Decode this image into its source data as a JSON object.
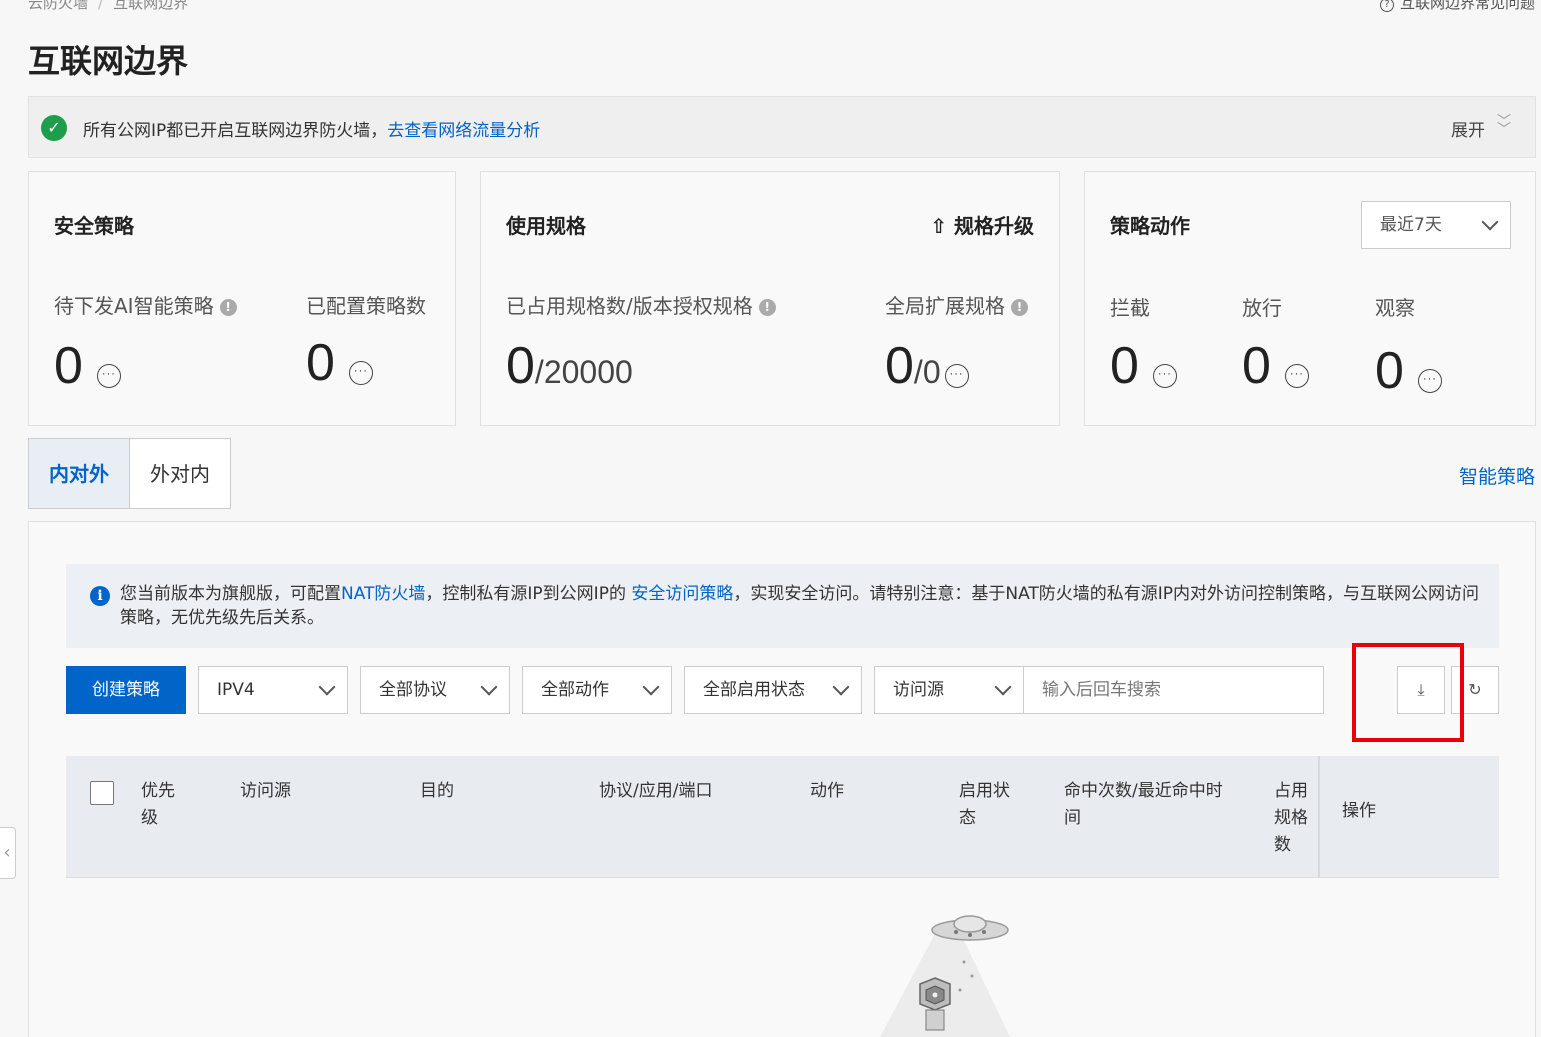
{
  "breadcrumb": {
    "parent": "云防火墙",
    "current": "互联网边界"
  },
  "help_link": "互联网边界常见问题",
  "page_title": "互联网边界",
  "notice": {
    "text": "所有公网IP都已开启互联网边界防火墙，",
    "link": "去查看网络流量分析",
    "expand": "展开"
  },
  "cards": {
    "security": {
      "title": "安全策略",
      "pending_label": "待下发AI智能策略",
      "pending_value": "0",
      "configured_label": "已配置策略数",
      "configured_value": "0"
    },
    "usage": {
      "title": "使用规格",
      "upgrade": "规格升级",
      "occupied_label": "已占用规格数/版本授权规格",
      "occupied_value": "0",
      "occupied_total": "/20000",
      "global_label": "全局扩展规格",
      "global_value": "0",
      "global_total": "/0"
    },
    "actions": {
      "title": "策略动作",
      "range": "最近7天",
      "block_label": "拦截",
      "block_value": "0",
      "allow_label": "放行",
      "allow_value": "0",
      "observe_label": "观察",
      "observe_value": "0"
    }
  },
  "tabs": {
    "active": "内对外",
    "other": "外对内"
  },
  "smart_policy": "智能策略",
  "alert": {
    "p1": "您当前版本为旗舰版，可配置",
    "nat_link": "NAT防火墙",
    "p2": "，控制私有源IP到公网IP的 ",
    "policy_link": "安全访问策略",
    "p3": "，实现安全访问。请特别注意：基于NAT防火墙的私有源IP内对外访问控制策略，与互联网公网访问策略，无优先级先后关系。"
  },
  "toolbar": {
    "create": "创建策略",
    "ip_version": "IPV4",
    "protocol": "全部协议",
    "action": "全部动作",
    "status": "全部启用状态",
    "source": "访问源",
    "search_placeholder": "输入后回车搜索"
  },
  "table": {
    "columns": [
      "优先级",
      "访问源",
      "目的",
      "协议/应用/端口",
      "动作",
      "启用状态",
      "命中次数/最近命中时间",
      "占用规格数",
      "操作"
    ]
  },
  "colors": {
    "primary": "#0064c8",
    "success": "#1e9e4b",
    "highlight": "#e8000b"
  }
}
